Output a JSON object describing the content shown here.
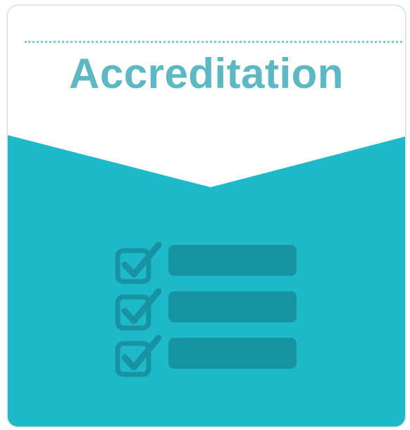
{
  "title": "Accreditation",
  "colors": {
    "teal_background": "#1fbac9",
    "title_color": "#5cb8c3",
    "icon_color": "#1793a4",
    "header_background": "#ffffff"
  },
  "checklist": {
    "items": [
      {
        "icon": "checked-box-icon",
        "checked": true
      },
      {
        "icon": "checked-box-icon",
        "checked": true
      },
      {
        "icon": "checked-box-icon",
        "checked": true
      }
    ]
  }
}
